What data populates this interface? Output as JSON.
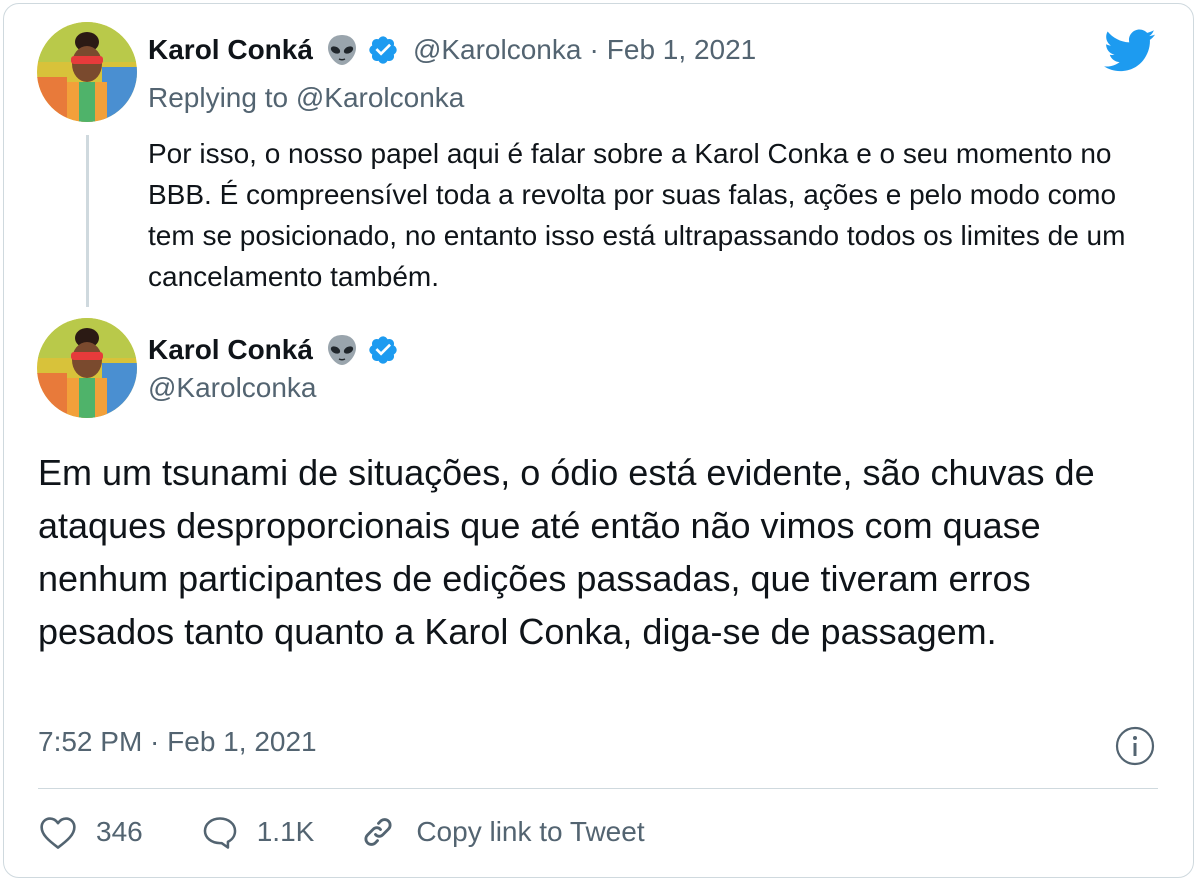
{
  "reply_tweet": {
    "display_name": "Karol Conká",
    "handle": "@Karolconka",
    "separator": "·",
    "date": "Feb 1, 2021",
    "replying_to": "Replying to @Karolconka",
    "text": "Por isso, o nosso papel aqui é falar sobre a Karol Conka e o seu momento no BBB. É compreensível toda a revolta por suas falas, ações e pelo modo como tem se posicionado, no entanto isso está ultrapassando todos os limites de um cancelamento também."
  },
  "main_tweet": {
    "display_name": "Karol Conká",
    "handle": "@Karolconka",
    "text": "Em um tsunami de situações, o ódio está evidente, são chuvas de ataques desproporcionais que até então não vimos com quase nenhum participantes de edições passadas, que tiveram erros pesados tanto quanto a Karol Conka, diga-se de passagem.",
    "timestamp": "7:52 PM · Feb 1, 2021"
  },
  "actions": {
    "like_count": "346",
    "reply_count": "1.1K",
    "copy_link_label": "Copy link to Tweet"
  },
  "icons": {
    "brand": "twitter-bird-icon",
    "emoji": "alien-icon",
    "verified": "verified-badge-icon",
    "info": "info-icon",
    "like": "heart-icon",
    "reply": "speech-bubble-icon",
    "link": "link-icon"
  },
  "colors": {
    "brand_blue": "#1d9bf0",
    "text_primary": "#0f1419",
    "text_secondary": "#536471",
    "border": "#cfd9de"
  }
}
